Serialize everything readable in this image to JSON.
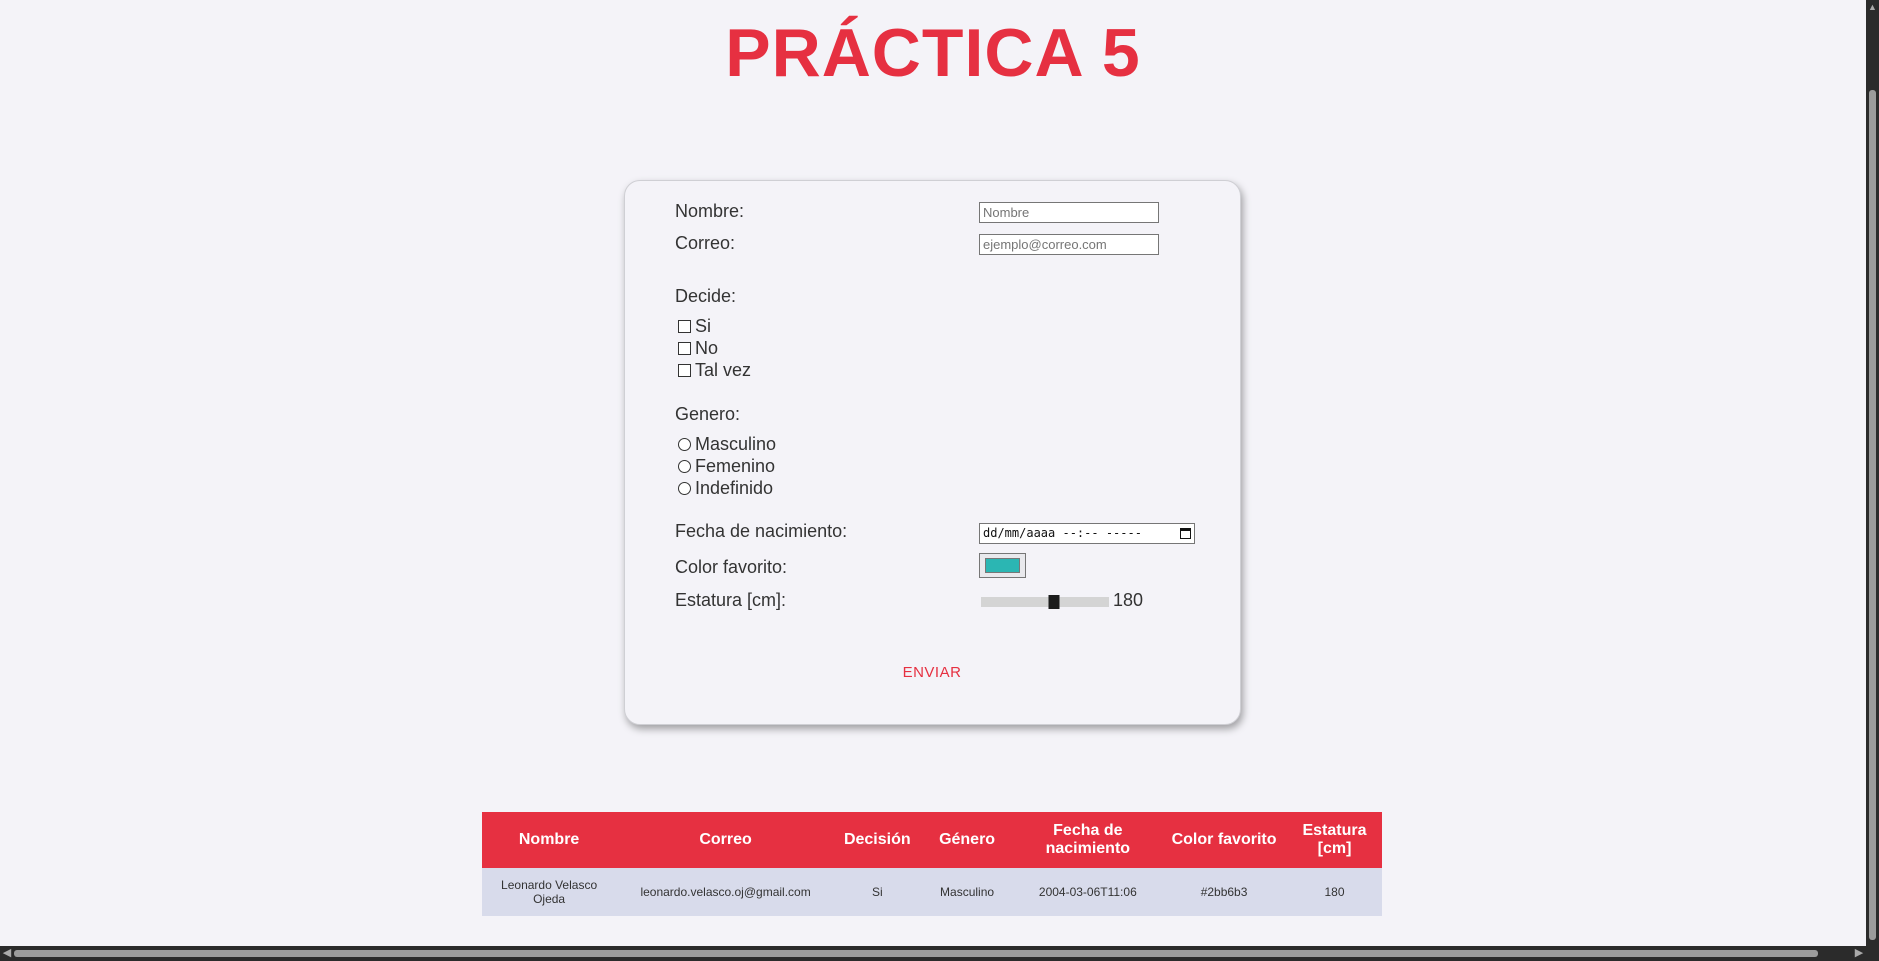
{
  "page": {
    "title": "PRÁCTICA 5"
  },
  "form": {
    "nombre_label": "Nombre:",
    "nombre_placeholder": "Nombre",
    "correo_label": "Correo:",
    "correo_placeholder": "ejemplo@correo.com",
    "decide_label": "Decide:",
    "decide_options": [
      "Si",
      "No",
      "Tal vez"
    ],
    "genero_label": "Genero:",
    "genero_options": [
      "Masculino",
      "Femenino",
      "Indefinido"
    ],
    "fecha_label": "Fecha de nacimiento:",
    "fecha_value": "dd/mm/aaaa --:-- -----",
    "color_label": "Color favorito:",
    "color_value": "#2bb6b3",
    "estatura_label": "Estatura [cm]:",
    "estatura_value": "180",
    "estatura_fraction": 0.57,
    "submit_label": "ENVIAR"
  },
  "table": {
    "headers": [
      "Nombre",
      "Correo",
      "Decisión",
      "Género",
      "Fecha de nacimiento",
      "Color favorito",
      "Estatura [cm]"
    ],
    "rows": [
      [
        "Leonardo Velasco Ojeda",
        "leonardo.velasco.oj@gmail.com",
        "Si",
        "Masculino",
        "2004-03-06T11:06",
        "#2bb6b3",
        "180"
      ]
    ]
  },
  "colors": {
    "accent": "#e63041",
    "background": "#f4f3f8",
    "table_row": "#d8dbeb"
  }
}
